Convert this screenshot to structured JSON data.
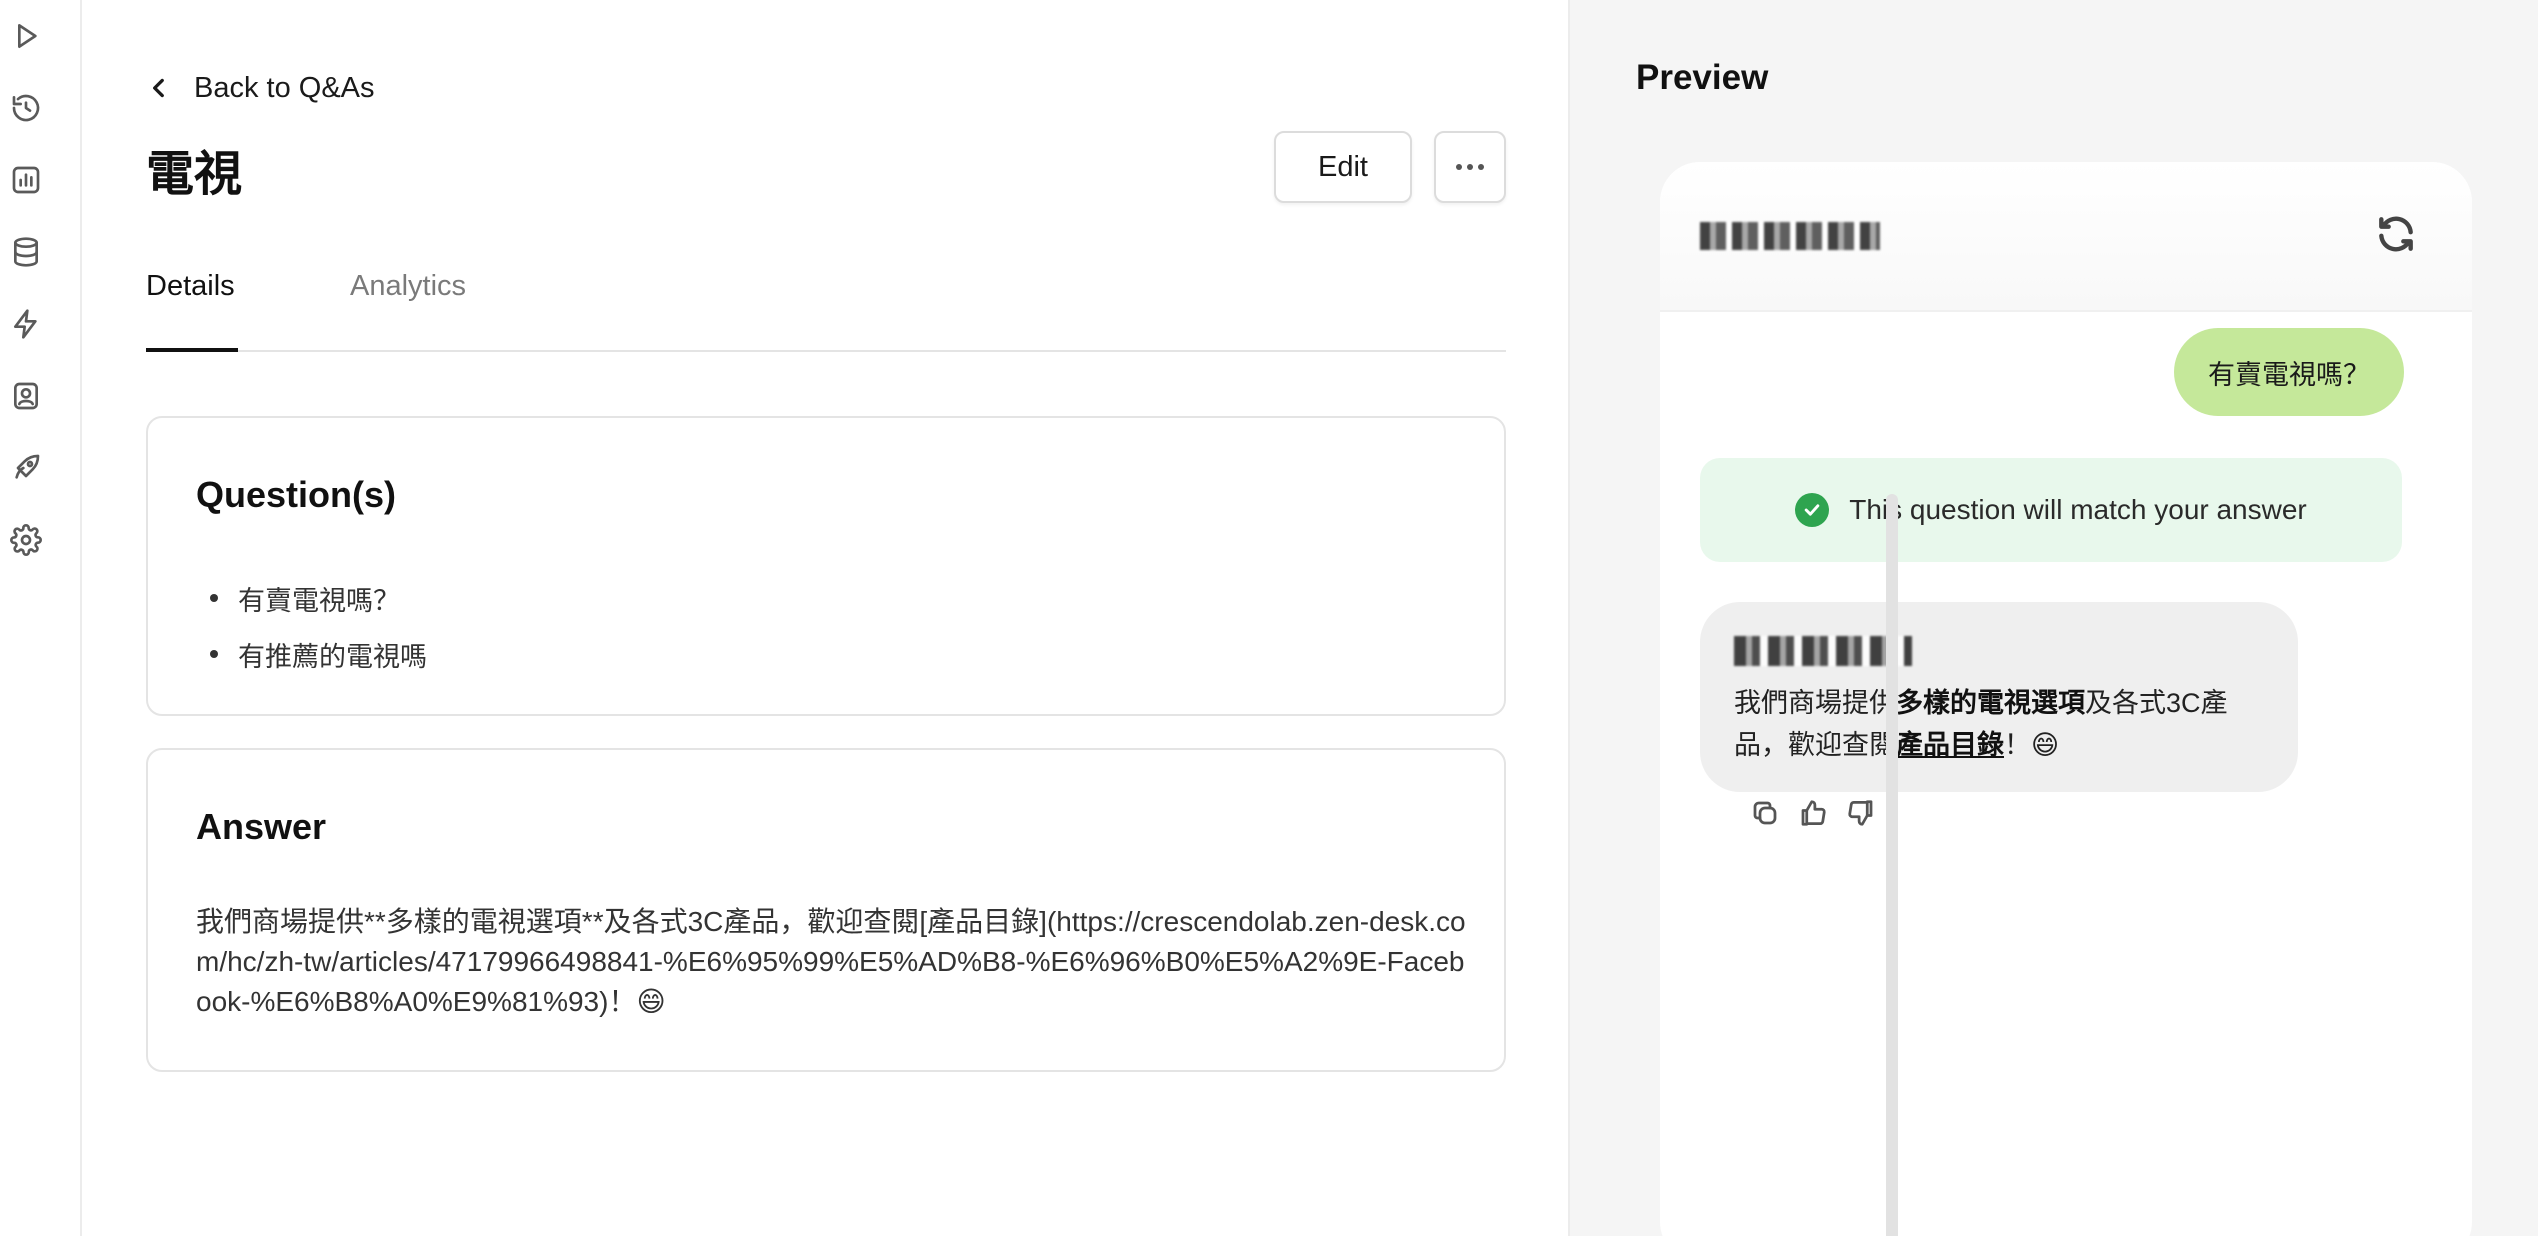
{
  "nav": {
    "back_label": "Back to Q&As"
  },
  "page": {
    "title": "電視",
    "edit_label": "Edit"
  },
  "tabs": [
    {
      "label": "Details",
      "active": true
    },
    {
      "label": "Analytics",
      "active": false
    }
  ],
  "questions": {
    "heading": "Question(s)",
    "items": [
      "有賣電視嗎？",
      "有推薦的電視嗎"
    ]
  },
  "answer": {
    "heading": "Answer",
    "text": "我們商場提供**多樣的電視選項**及各式3C產品，歡迎查閱[產品目錄](https://crescendolab.zen-desk.com/hc/zh-tw/articles/47179966498841-%E6%95%99%E5%AD%B8-%E6%96%B0%E5%A2%9E-Facebook-%E6%B8%A0%E9%81%93)！😄"
  },
  "preview": {
    "title": "Preview",
    "user_message": "有賣電視嗎？",
    "match_notice": "This question will match your answer",
    "bot_text_pre": "我們商場提供",
    "bot_text_bold": "多樣的電視選項",
    "bot_text_mid": "及各式3C產品，歡迎查閱",
    "bot_text_link": "產品目錄",
    "bot_text_post": "！😄"
  },
  "colors": {
    "user_bubble": "#c5e89a",
    "match_bg": "#e8f8ec",
    "check": "#2ea44f"
  }
}
